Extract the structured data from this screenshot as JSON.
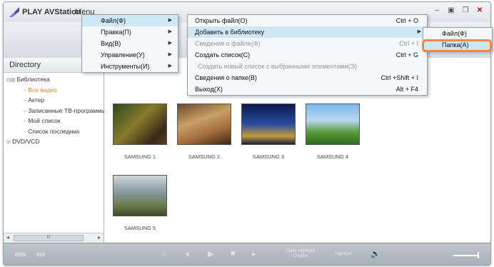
{
  "window": {
    "app_title": "PLAY AVStation",
    "menu_label": "Menu",
    "controls": [
      "minimize-icon",
      "maximize-icon",
      "restore-icon",
      "close-icon"
    ]
  },
  "sidebar": {
    "header": "Directory",
    "tree": [
      {
        "label": "Библиотека",
        "level": 0,
        "icon": "library-icon"
      },
      {
        "label": "Все видео",
        "level": 1,
        "active": true
      },
      {
        "label": "Актер",
        "level": 1
      },
      {
        "label": "Записанные ТВ-программы",
        "level": 1
      },
      {
        "label": "Мой список",
        "level": 1
      },
      {
        "label": "Список последних",
        "level": 1
      },
      {
        "label": "DVD/VCD",
        "level": 0,
        "icon": "disc-icon"
      }
    ],
    "scrollbar_thumb": "III"
  },
  "thumbnails": [
    {
      "caption": "SAMSUNG 1"
    },
    {
      "caption": "SAMSUNG 2"
    },
    {
      "caption": "SAMSUNG 3"
    },
    {
      "caption": "SAMSUNG 4"
    },
    {
      "caption": "SAMSUNG 5"
    }
  ],
  "bottom_bar": {
    "left_labels": [
      "EDS",
      "EDI"
    ],
    "make_label": "Make Highlight Chapter",
    "highlight_label": "Highlight"
  },
  "main_menu": [
    {
      "label": "Файл(Ф)",
      "highlighted": true
    },
    {
      "label": "Правка(П)"
    },
    {
      "label": "Вид(В)"
    },
    {
      "label": "Управление(У)"
    },
    {
      "label": "Инструменты(И)"
    }
  ],
  "file_menu": [
    {
      "label": "Открыть файл(О)",
      "shortcut": "Ctrl + O"
    },
    {
      "label": "Добавить в библиотеку",
      "submenu": true,
      "highlighted": true
    },
    {
      "label": "Сведения о файле(Ф)",
      "shortcut": "Ctrl + I",
      "disabled": true
    },
    {
      "label": "Создать список(С)",
      "shortcut": "Ctrl + G"
    },
    {
      "label": "Создать новый список с выбранными элементами(Э)",
      "disabled": true
    },
    {
      "label": "Сведения о папке(В)",
      "shortcut": "Ctrl +Shift + I"
    },
    {
      "label": "Выход(Х)",
      "shortcut": "Alt + F4"
    }
  ],
  "library_menu": [
    {
      "label": "Файл(Ф)"
    },
    {
      "label": "Папка(А)",
      "highlighted": true
    }
  ],
  "colors": {
    "menu_highlight": "#cfe6f5",
    "focus_ring": "#f0884a",
    "active_tree_item": "#e67e22"
  }
}
